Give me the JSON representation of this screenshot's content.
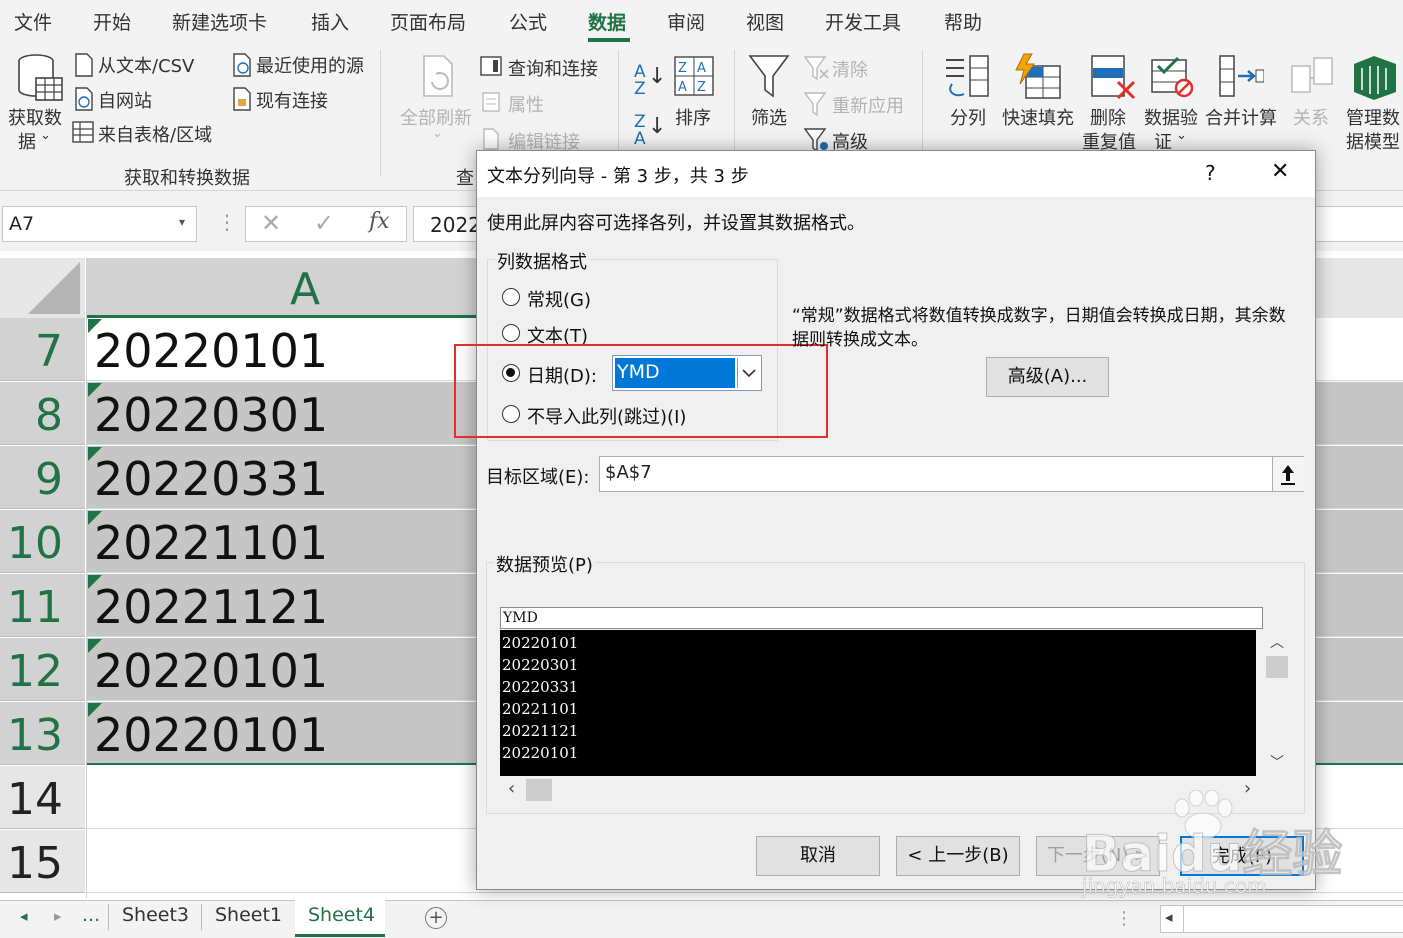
{
  "menu": {
    "tabs": [
      "文件",
      "开始",
      "新建选项卡",
      "插入",
      "页面布局",
      "公式",
      "数据",
      "审阅",
      "视图",
      "开发工具",
      "帮助"
    ],
    "active_tab": "数据"
  },
  "ribbon": {
    "get_data_line1": "获取数",
    "get_data_line2": "据",
    "from_text_csv": "从文本/CSV",
    "from_web": "自网站",
    "from_table": "来自表格/区域",
    "recent_sources": "最近使用的源",
    "existing_connections": "现有连接",
    "group_get_transform": "获取和转换数据",
    "refresh_all": "全部刷新",
    "queries_connections": "查询和连接",
    "properties": "属性",
    "edit_links": "编辑链接",
    "group_queries_partial": "查",
    "sort": "排序",
    "filter": "筛选",
    "clear": "清除",
    "reapply": "重新应用",
    "advanced": "高级",
    "text_to_columns": "分列",
    "flash_fill": "快速填充",
    "remove_dup_line1": "删除",
    "remove_dup_line2": "重复值",
    "data_valid_line1": "数据验",
    "data_valid_line2": "证",
    "consolidate": "合并计算",
    "relationships": "关系",
    "manage_model_line1": "管理数",
    "manage_model_line2": "据模型"
  },
  "formula_bar": {
    "name_box": "A7",
    "fx": "fx",
    "content_partial": "2022"
  },
  "grid": {
    "column_label": "A",
    "rows": [
      {
        "num": "7",
        "value": "20220101"
      },
      {
        "num": "8",
        "value": "20220301"
      },
      {
        "num": "9",
        "value": "20220331"
      },
      {
        "num": "10",
        "value": "20221101"
      },
      {
        "num": "11",
        "value": "20221121"
      },
      {
        "num": "12",
        "value": "20220101"
      },
      {
        "num": "13",
        "value": "20220101"
      },
      {
        "num": "14",
        "value": ""
      },
      {
        "num": "15",
        "value": ""
      }
    ]
  },
  "sheets": {
    "ellipsis": "...",
    "tabs": [
      "Sheet3",
      "Sheet1",
      "Sheet4"
    ],
    "active": "Sheet4",
    "add": "+"
  },
  "dialog": {
    "title": "文本分列向导 - 第 3 步，共 3 步",
    "help": "?",
    "close": "✕",
    "instruction": "使用此屏内容可选择各列，并设置其数据格式。",
    "format_group": "列数据格式",
    "opt_general": "常规(G)",
    "opt_text": "文本(T)",
    "opt_date": "日期(D):",
    "opt_skip": "不导入此列(跳过)(I)",
    "date_format": "YMD",
    "description": "“常规”数据格式将数值转换成数字，日期值会转换成日期，其余数据则转换成文本。",
    "advanced_btn": "高级(A)...",
    "dest_label": "目标区域(E):",
    "dest_value": "$A$7",
    "preview_label": "数据预览(P)",
    "preview_header": "YMD",
    "preview_rows": [
      "20220101",
      "20220301",
      "20220331",
      "20221101",
      "20221121",
      "20220101"
    ],
    "cancel": "取消",
    "back": "< 上一步(B)",
    "next": "下一步(N) >",
    "finish": "完成(F)"
  },
  "watermark": {
    "brand": "Baidu经验",
    "url": "jingyan.baidu.com"
  },
  "colors": {
    "excel_green": "#217346",
    "highlight_red": "#e0302e",
    "selection_blue": "#0078d7"
  }
}
